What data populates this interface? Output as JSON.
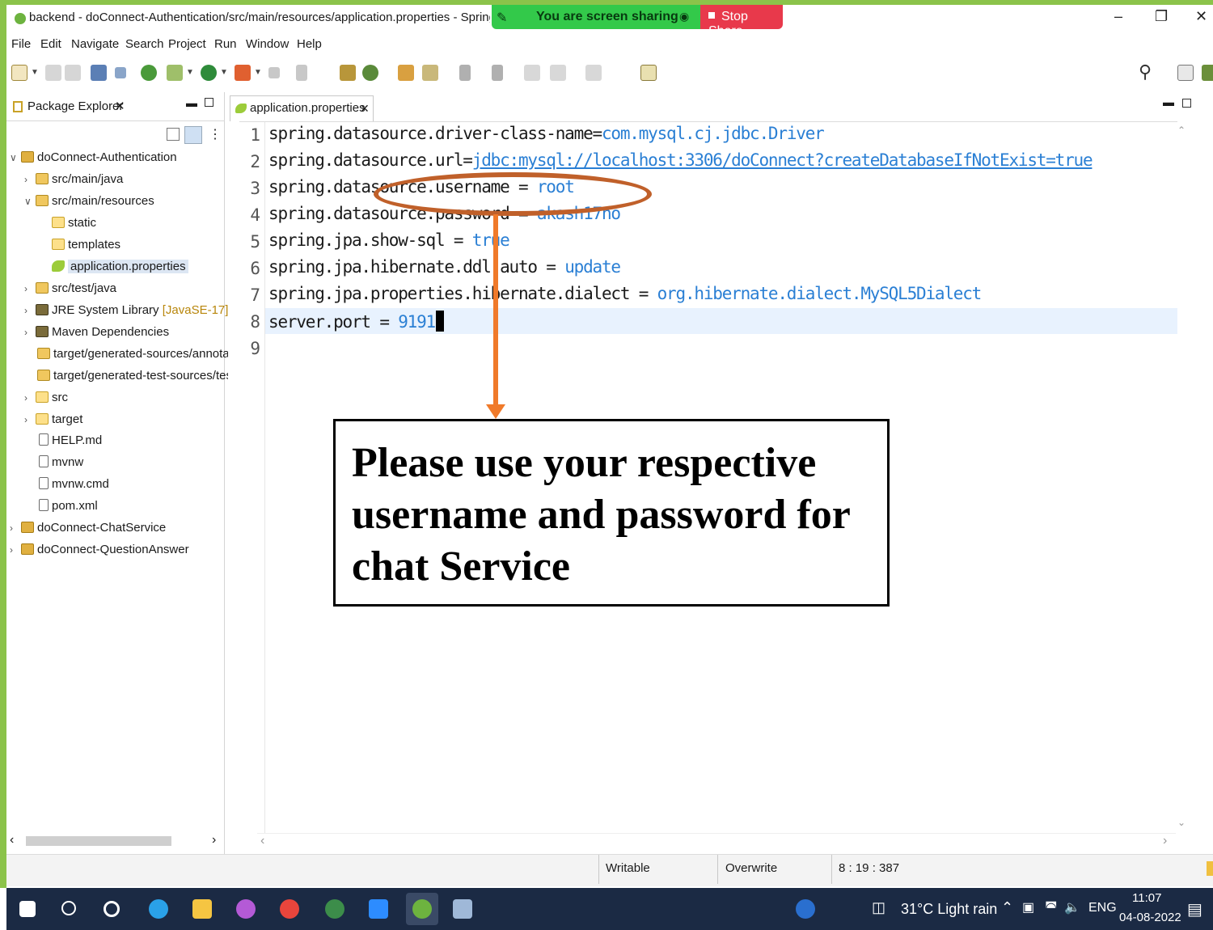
{
  "titlebar": {
    "title": "backend - doConnect-Authentication/src/main/resources/application.properties - Spring Tool Sui",
    "share_status": "You are screen sharing",
    "stop_share": "Stop Share",
    "minimize": "–",
    "restore": "❐",
    "close": "✕"
  },
  "menu": [
    "File",
    "Edit",
    "Navigate",
    "Search",
    "Project",
    "Run",
    "Window",
    "Help"
  ],
  "package_explorer": {
    "tab_label": "Package Explorer",
    "tree": {
      "project_auth": "doConnect-Authentication",
      "src_main_java": "src/main/java",
      "src_main_resources": "src/main/resources",
      "static": "static",
      "templates": "templates",
      "application_properties": "application.properties",
      "src_test_java": "src/test/java",
      "jre_library": "JRE System Library",
      "jre_version": "[JavaSE-17]",
      "maven_deps": "Maven Dependencies",
      "target_gen_sources": "target/generated-sources/annotatic",
      "target_gen_test_sources": "target/generated-test-sources/test-",
      "src": "src",
      "target": "target",
      "help_md": "HELP.md",
      "mvnw": "mvnw",
      "mvnw_cmd": "mvnw.cmd",
      "pom_xml": "pom.xml",
      "project_chat": "doConnect-ChatService",
      "project_qa": "doConnect-QuestionAnswer"
    }
  },
  "editor": {
    "tab_label": "application.properties",
    "line_numbers": [
      "1",
      "2",
      "3",
      "4",
      "5",
      "6",
      "7",
      "8",
      "9"
    ],
    "lines": [
      {
        "key": "spring.datasource.driver-class-name=",
        "value": "com.mysql.cj.jdbc.Driver"
      },
      {
        "key": "spring.datasource.url=",
        "value": "jdbc:mysql://localhost:3306/doConnect?createDatabaseIfNotExist=true"
      },
      {
        "key": "spring.datasource.username = ",
        "value": "root"
      },
      {
        "key": "spring.datasource.password = ",
        "value": "akash17no"
      },
      {
        "key": "spring.jpa.show-sql = ",
        "value": "true"
      },
      {
        "key": "spring.jpa.hibernate.ddl-auto = ",
        "value": "update"
      },
      {
        "key": "spring.jpa.properties.hibernate.dialect = ",
        "value": "org.hibernate.dialect.MySQL5Dialect"
      },
      {
        "key": "server.port = ",
        "value": "9191"
      }
    ]
  },
  "annotation": {
    "note": "Please use your respective username and password for chat Service"
  },
  "statusbar": {
    "writable": "Writable",
    "insert_mode": "Overwrite",
    "position": "8 : 19 : 387"
  },
  "taskbar": {
    "weather": "31°C  Light rain",
    "language": "ENG",
    "time": "11:07",
    "date": "04-08-2022"
  },
  "colors": {
    "share_border": "#8bc34a",
    "value_text": "#2a7fd4",
    "annotation_orange": "#f07a2a",
    "taskbar_bg": "#1b2a44"
  }
}
